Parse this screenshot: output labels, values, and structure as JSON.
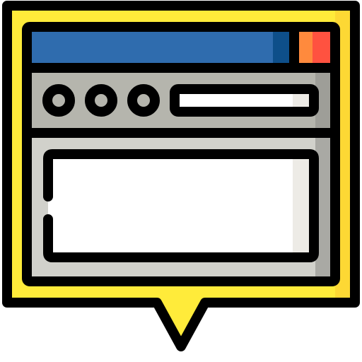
{
  "icon": {
    "name": "browser-window-speech-bubble-icon",
    "colors": {
      "outline": "#000000",
      "bubble": "#FFEB3A",
      "bubble_shade": "#FDD834",
      "title_bar": "#2F6CAE",
      "title_bar_shade": "#0E4F8A",
      "close_button": "#FF5240",
      "close_button_shade": "#FF8A3D",
      "toolbar": "#B5B5AD",
      "toolbar_shade": "#9E9E98",
      "content_area": "#D1D1CB",
      "content_area_shade": "#A9A9A4",
      "panel": "#FFFFFF",
      "panel_shade": "#EDEBE6",
      "control_dot": "#B5B5AD"
    },
    "control_dots": [
      "dot-1",
      "dot-2",
      "dot-3"
    ]
  }
}
